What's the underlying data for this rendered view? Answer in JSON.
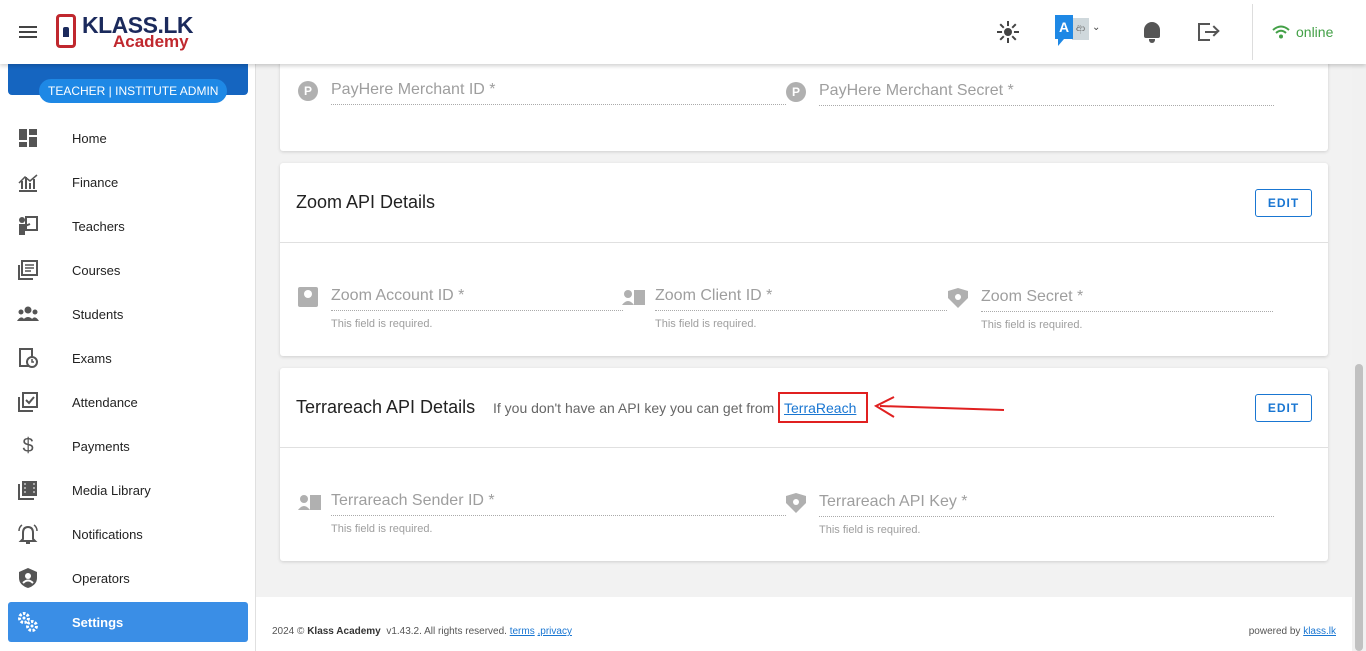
{
  "app": {
    "logo_brand": "KLASS.LK",
    "logo_sub": "Academy",
    "status": "online"
  },
  "sidebar": {
    "role": "TEACHER | INSTITUTE ADMIN",
    "items": [
      {
        "label": "Home",
        "icon": "dashboard-icon"
      },
      {
        "label": "Finance",
        "icon": "finance-chart-icon"
      },
      {
        "label": "Teachers",
        "icon": "teacher-icon"
      },
      {
        "label": "Courses",
        "icon": "courses-icon"
      },
      {
        "label": "Students",
        "icon": "students-icon"
      },
      {
        "label": "Exams",
        "icon": "exams-icon"
      },
      {
        "label": "Attendance",
        "icon": "attendance-icon"
      },
      {
        "label": "Payments",
        "icon": "dollar-icon"
      },
      {
        "label": "Media Library",
        "icon": "media-icon"
      },
      {
        "label": "Notifications",
        "icon": "bell-alert-icon"
      },
      {
        "label": "Operators",
        "icon": "operator-shield-icon"
      },
      {
        "label": "Settings",
        "icon": "settings-gears-icon",
        "active": true
      }
    ]
  },
  "payhere": {
    "merchant_id": "PayHere Merchant ID *",
    "merchant_secret": "PayHere Merchant Secret *"
  },
  "zoom": {
    "title": "Zoom API Details",
    "edit": "EDIT",
    "account_id": "Zoom Account ID *",
    "client_id": "Zoom Client ID *",
    "secret": "Zoom Secret *",
    "required": "This field is required."
  },
  "terrareach": {
    "title": "Terrareach API Details",
    "hint": "If you don't have an API key you can get from",
    "link": "TerraReach",
    "edit": "EDIT",
    "sender_id": "Terrareach Sender ID *",
    "api_key": "Terrareach API Key *",
    "required": "This field is required."
  },
  "footer": {
    "year": "2024 ©",
    "company": "Klass Academy",
    "rights": "v1.43.2. All rights reserved.",
    "terms": "terms",
    "privacy": ",privacy",
    "powered": "powered by",
    "powered_link": "klass.lk"
  },
  "colors": {
    "primary": "#1976d2",
    "active_nav": "#3a8ee6",
    "online": "#43a047",
    "annotation": "#e02020"
  }
}
